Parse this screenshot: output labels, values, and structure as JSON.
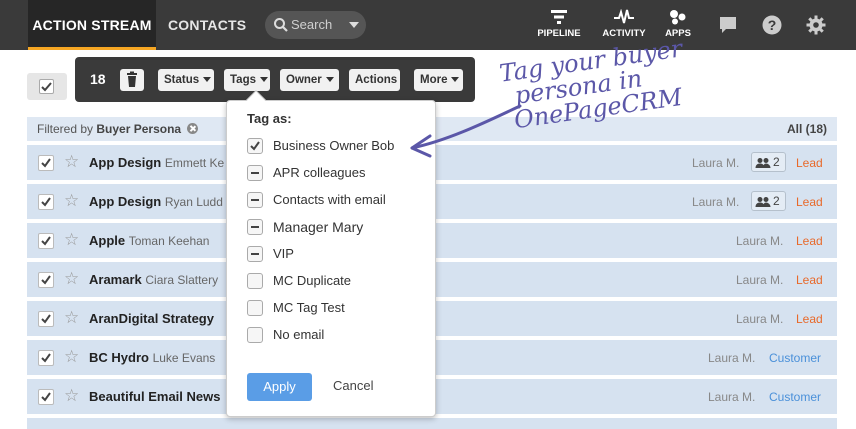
{
  "nav": {
    "active_tab": "ACTION STREAM",
    "contacts_tab": "CONTACTS",
    "search_placeholder": "Search",
    "pipeline": "PIPELINE",
    "activity": "ACTIVITY",
    "apps": "APPS"
  },
  "toolbar": {
    "selected_count": "18",
    "status": "Status",
    "tags": "Tags",
    "owner": "Owner",
    "actions": "Actions",
    "more": "More"
  },
  "filter": {
    "prefix": "Filtered by",
    "value": "Buyer Persona",
    "all_count": "All (18)"
  },
  "rows": [
    {
      "company": "App Design",
      "contact": "Emmett Ke",
      "owner": "Laura M.",
      "people": "2",
      "status": "Lead"
    },
    {
      "company": "App Design",
      "contact": "Ryan Ludd",
      "owner": "Laura M.",
      "people": "2",
      "status": "Lead"
    },
    {
      "company": "Apple",
      "contact": "Toman  Keehan",
      "owner": "Laura M.",
      "status": "Lead"
    },
    {
      "company": "Aramark",
      "contact": "Ciara Slattery",
      "owner": "Laura M.",
      "status": "Lead"
    },
    {
      "company": "Aran",
      "contact": "Digital Strategy",
      "owner": "Laura M.",
      "status": "Lead"
    },
    {
      "company": "BC Hydro",
      "contact": "Luke Evans",
      "owner": "Laura M.",
      "status": "Customer"
    },
    {
      "company": "Beautiful Email News",
      "contact": "",
      "owner": "Laura M.",
      "status": "Customer"
    }
  ],
  "tag_popup": {
    "title": "Tag as:",
    "items": [
      {
        "label": "Business Owner Bob",
        "state": "checked"
      },
      {
        "label": "APR colleagues",
        "state": "partial"
      },
      {
        "label": "Contacts with email",
        "state": "partial"
      },
      {
        "label": "Manager Mary",
        "state": "partial"
      },
      {
        "label": "VIP",
        "state": "partial"
      },
      {
        "label": "MC Duplicate",
        "state": "unchecked"
      },
      {
        "label": "MC Tag Test",
        "state": "unchecked"
      },
      {
        "label": "No email",
        "state": "unchecked"
      }
    ],
    "apply": "Apply",
    "cancel": "Cancel"
  },
  "annotation": {
    "line1": "Tag your buyer",
    "line2": "persona in",
    "line3": "OnePageCRM"
  },
  "colors": {
    "lead": "#e8692a",
    "customer": "#4a90d9",
    "accent": "#f5a623",
    "annotation": "#5b57a8"
  }
}
